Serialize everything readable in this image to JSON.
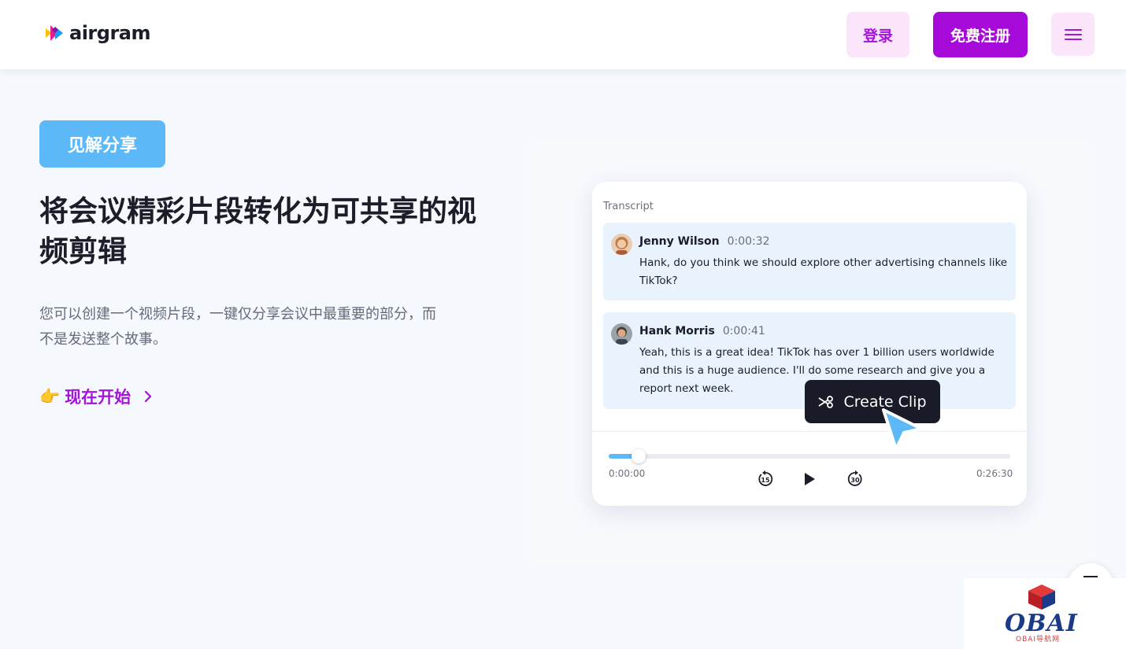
{
  "header": {
    "logo_text": "airgram",
    "login_label": "登录",
    "signup_label": "免费注册",
    "menu_icon": "hamburger-icon"
  },
  "hero": {
    "badge": "见解分享",
    "title": "将会议精彩片段转化为可共享的视频剪辑",
    "description": "您可以创建一个视频片段，一键仅分享会议中最重要的部分，而不是发送整个故事。",
    "cta_label": "现在开始",
    "cta_emoji": "👉"
  },
  "transcript": {
    "label": "Transcript",
    "messages": [
      {
        "name": "Jenny Wilson",
        "time": "0:00:32",
        "text": "Hank, do you think we should explore other advertising channels like TikTok?"
      },
      {
        "name": "Hank Morris",
        "time": "0:00:41",
        "text": "Yeah, this is a great idea! TikTok has over 1 billion users worldwide and this is a huge audience. I'll do some research and give you a report next week."
      }
    ],
    "player": {
      "current_time": "0:00:00",
      "total_time": "0:26:30",
      "progress": 0.065,
      "rewind_icon": "rewind-15-icon",
      "play_icon": "play-icon",
      "forward_icon": "forward-30-icon"
    },
    "create_clip_label": "Create Clip"
  },
  "watermark": {
    "text": "OBAI",
    "subtext": "OBAI导航网"
  },
  "colors": {
    "brand_purple": "#a50ad9",
    "accent_blue": "#5db8f8",
    "dark": "#1a1b29"
  }
}
